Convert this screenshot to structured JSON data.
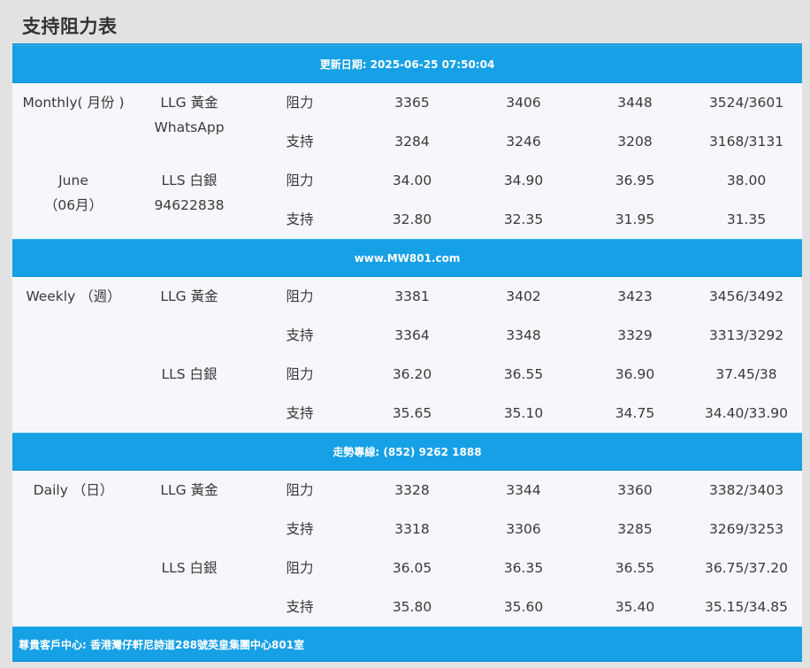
{
  "page": {
    "title": "支持阻力表"
  },
  "bands": {
    "updated": "更新日期: 2025-06-25 07:50:04",
    "website": "www.MW801.com",
    "hotline": "走勢專線: (852) 9262 1888",
    "address": "尊貴客戶中心: 香港灣仔軒尼詩道288號英皇集團中心801室"
  },
  "monthly": {
    "period_line1": "Monthly( 月份 )",
    "period_line2": "June",
    "period_line3": "（06月）",
    "gold_label": "LLG 黃金",
    "gold_sub": "WhatsApp",
    "silver_label": "LLS 白銀",
    "silver_sub": "94622838",
    "rows": [
      {
        "type": "阻力",
        "v": [
          "3365",
          "3406",
          "3448",
          "3524/3601"
        ]
      },
      {
        "type": "支持",
        "v": [
          "3284",
          "3246",
          "3208",
          "3168/3131"
        ]
      },
      {
        "type": "阻力",
        "v": [
          "34.00",
          "34.90",
          "36.95",
          "38.00"
        ]
      },
      {
        "type": "支持",
        "v": [
          "32.80",
          "32.35",
          "31.95",
          "31.35"
        ]
      }
    ]
  },
  "weekly": {
    "period": "Weekly （週）",
    "gold_label": "LLG 黃金",
    "silver_label": "LLS 白銀",
    "rows": [
      {
        "type": "阻力",
        "v": [
          "3381",
          "3402",
          "3423",
          "3456/3492"
        ]
      },
      {
        "type": "支持",
        "v": [
          "3364",
          "3348",
          "3329",
          "3313/3292"
        ]
      },
      {
        "type": "阻力",
        "v": [
          "36.20",
          "36.55",
          "36.90",
          "37.45/38"
        ]
      },
      {
        "type": "支持",
        "v": [
          "35.65",
          "35.10",
          "34.75",
          "34.40/33.90"
        ]
      }
    ]
  },
  "daily": {
    "period": "Daily （日）",
    "gold_label": "LLG 黃金",
    "silver_label": "LLS 白銀",
    "rows": [
      {
        "type": "阻力",
        "v": [
          "3328",
          "3344",
          "3360",
          "3382/3403"
        ]
      },
      {
        "type": "支持",
        "v": [
          "3318",
          "3306",
          "3285",
          "3269/3253"
        ]
      },
      {
        "type": "阻力",
        "v": [
          "36.05",
          "36.35",
          "36.55",
          "36.75/37.20"
        ]
      },
      {
        "type": "支持",
        "v": [
          "35.80",
          "35.60",
          "35.40",
          "35.15/34.85"
        ]
      }
    ]
  }
}
